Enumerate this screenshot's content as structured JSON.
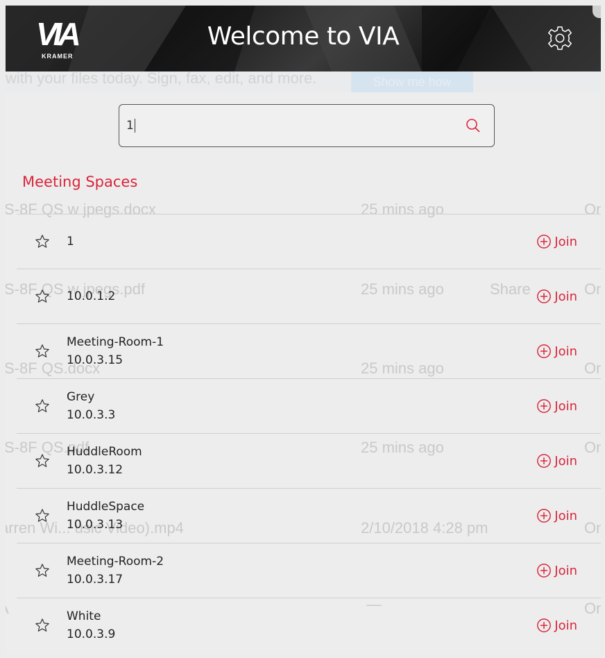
{
  "header": {
    "logo_text": "VIA",
    "logo_sub": "KRAMER",
    "title": "Welcome to VIA",
    "settings_icon": "gear-icon"
  },
  "ghost": {
    "banner_text": "with your files today. Sign, fax, edit, and more.",
    "banner_button": "Show me how",
    "rows": [
      {
        "file": "S-8F QS w jpegs.docx",
        "time": "25 mins ago",
        "extra": "On"
      },
      {
        "file": "S-8F QS w jpegs.pdf",
        "time": "25 mins ago",
        "extra": "Share",
        "extra2": "On"
      },
      {
        "file": "S-8F QS.docx",
        "time": "25 mins ago",
        "extra": "On"
      },
      {
        "file": "S-8F QS.pdf",
        "time": "25 mins ago",
        "extra": "On"
      },
      {
        "file": "arren Wi... usic Video).mp4",
        "time": "2/10/2018 4:28 pm",
        "extra": "On"
      },
      {
        "file": "A",
        "time": "—",
        "extra": "On"
      }
    ]
  },
  "search": {
    "value": "1",
    "icon": "search-icon"
  },
  "section": {
    "title": "Meeting Spaces"
  },
  "join_label": "Join",
  "spaces": [
    {
      "name": "1",
      "address": ""
    },
    {
      "name": "10.0.1.2",
      "address": ""
    },
    {
      "name": "Meeting-Room-1",
      "address": "10.0.3.15"
    },
    {
      "name": "Grey",
      "address": "10.0.3.3"
    },
    {
      "name": "HuddleRoom",
      "address": "10.0.3.12"
    },
    {
      "name": "HuddleSpace",
      "address": "10.0.3.13"
    },
    {
      "name": "Meeting-Room-2",
      "address": "10.0.3.17"
    },
    {
      "name": "White",
      "address": "10.0.3.9"
    }
  ],
  "colors": {
    "accent": "#d9253a",
    "header_bg": "#1f1f1f",
    "page_bg": "#ededed"
  }
}
